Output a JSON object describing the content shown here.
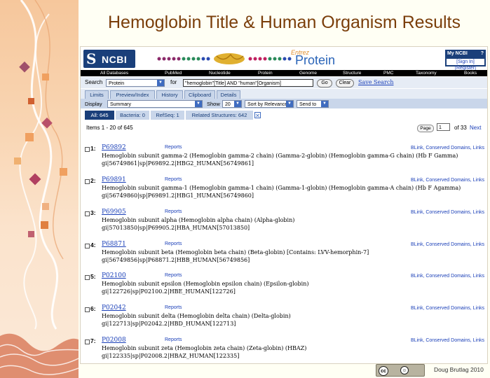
{
  "slide": {
    "title": "Hemoglobin Title & Human Organism Results",
    "author": "Doug Brutlag 2010",
    "license_badge": "cc"
  },
  "ncbi": {
    "logo_text": "NCBI",
    "entrez": "Entrez",
    "product": "Protein",
    "my_ncbi": "My NCBI",
    "help": "?",
    "sign_in": "[Sign In] [Register]"
  },
  "db_nav": [
    "All Databases",
    "PubMed",
    "Nucleotide",
    "Protein",
    "Genome",
    "Structure",
    "PMC",
    "Taxonomy",
    "Books"
  ],
  "search": {
    "label": "Search",
    "db_value": "Protein",
    "for_label": "for",
    "query": "\"hemoglobin\"[Title] AND \"human\"[Organism]",
    "go": "Go",
    "clear": "Clear",
    "save_search": "Save Search"
  },
  "tabs": [
    "Limits",
    "Preview/Index",
    "History",
    "Clipboard",
    "Details"
  ],
  "display": {
    "label": "Display",
    "format": "Summary",
    "show_label": "Show",
    "show_value": "20",
    "sort": "Sort by Relevance",
    "send_to": "Send to"
  },
  "filters": [
    "All: 645",
    "Bacteria: 0",
    "RefSeq: 1",
    "Related Structures: 642"
  ],
  "pager": {
    "items": "Items 1 - 20 of 645",
    "page_btn": "Page",
    "page_value": "1",
    "of": "of 33",
    "next": "Next"
  },
  "results": [
    {
      "num": "1:",
      "acc": "P69892",
      "reports": "Reports",
      "links": "BLink, Conserved Domains, Links",
      "title": "Hemoglobin subunit gamma-2 (Hemoglobin gamma-2 chain) (Gamma-2-globin) (Hemoglobin gamma-G chain) (Hb F Gamma)",
      "gi": "gi|56749861|sp|P69892.2|HBG2_HUMAN[56749861]"
    },
    {
      "num": "2:",
      "acc": "P69891",
      "reports": "Reports",
      "links": "BLink, Conserved Domains, Links",
      "title": "Hemoglobin subunit gamma-1 (Hemoglobin gamma-1 chain) (Gamma-1-globin) (Hemoglobin gamma-A chain) (Hb F Agamma)",
      "gi": "gi|56749860|sp|P69891.2|HBG1_HUMAN[56749860]"
    },
    {
      "num": "3:",
      "acc": "P69905",
      "reports": "Reports",
      "links": "BLink, Conserved Domains, Links",
      "title": "Hemoglobin subunit alpha (Hemoglobin alpha chain) (Alpha-globin)",
      "gi": "gi|57013850|sp|P69905.2|HBA_HUMAN[57013850]"
    },
    {
      "num": "4:",
      "acc": "P68871",
      "reports": "Reports",
      "links": "BLink, Conserved Domains, Links",
      "title": "Hemoglobin subunit beta (Hemoglobin beta chain) (Beta-globin) [Contains: LVV-hemorphin-7]",
      "gi": "gi|56749856|sp|P68871.2|HBB_HUMAN[56749856]"
    },
    {
      "num": "5:",
      "acc": "P02100",
      "reports": "Reports",
      "links": "BLink, Conserved Domains, Links",
      "title": "Hemoglobin subunit epsilon (Hemoglobin epsilon chain) (Epsilon-globin)",
      "gi": "gi|122726|sp|P02100.2|HBE_HUMAN[122726]"
    },
    {
      "num": "6:",
      "acc": "P02042",
      "reports": "Reports",
      "links": "BLink, Conserved Domains, Links",
      "title": "Hemoglobin subunit delta (Hemoglobin delta chain) (Delta-globin)",
      "gi": "gi|122713|sp|P02042.2|HBD_HUMAN[122713]"
    },
    {
      "num": "7:",
      "acc": "P02008",
      "reports": "Reports",
      "links": "BLink, Conserved Domains, Links",
      "title": "Hemoglobin subunit zeta (Hemoglobin zeta chain) (Zeta-globin) (HBAZ)",
      "gi": "gi|122335|sp|P02008.2|HBAZ_HUMAN[122335]"
    }
  ]
}
